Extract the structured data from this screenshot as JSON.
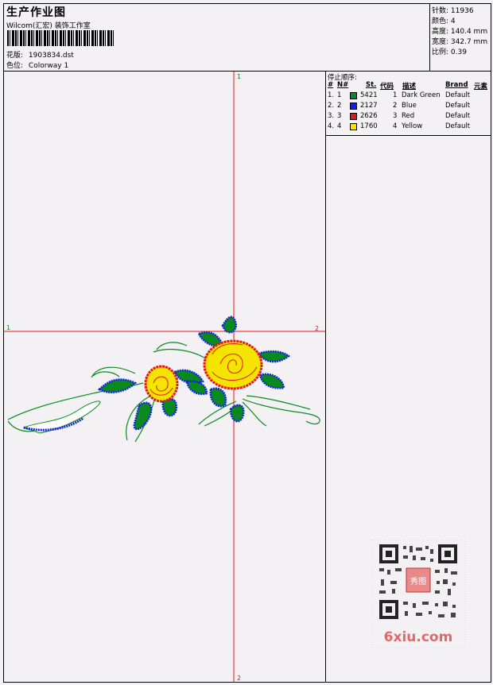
{
  "header": {
    "title": "生产作业图",
    "company": "Wilcom(汇宏) 装饰工作室",
    "design_file_label": "花版:",
    "design_file": "1903834.dst",
    "colorway_label": "色位:",
    "colorway": "Colorway 1"
  },
  "stats": [
    {
      "label": "针数:",
      "value": "11936"
    },
    {
      "label": "颜色:",
      "value": "4"
    },
    {
      "label": "高度:",
      "value": "140.4 mm"
    },
    {
      "label": "宽度:",
      "value": "342.7 mm"
    },
    {
      "label": "比例:",
      "value": "0.39"
    }
  ],
  "stop_sequence": {
    "title": "停止顺序:",
    "columns": {
      "num": "#",
      "needle": "N#",
      "stitches": "St.",
      "code": "代码",
      "description": "描述",
      "brand": "Brand",
      "element": "元素"
    },
    "rows": [
      {
        "num": "1.",
        "needle": "1",
        "color": "#0a8a1e",
        "stitches": "5421",
        "code": "1",
        "description": "Dark Green",
        "brand": "Default"
      },
      {
        "num": "2.",
        "needle": "2",
        "color": "#1020e0",
        "stitches": "2127",
        "code": "2",
        "description": "Blue",
        "brand": "Default"
      },
      {
        "num": "3.",
        "needle": "3",
        "color": "#e01818",
        "stitches": "2626",
        "code": "3",
        "description": "Red",
        "brand": "Default"
      },
      {
        "num": "4.",
        "needle": "4",
        "color": "#f4e400",
        "stitches": "1760",
        "code": "4",
        "description": "Yellow",
        "brand": "Default"
      }
    ]
  },
  "axis_labels": {
    "top": "1",
    "bottom": "2",
    "left": "1",
    "right": "2"
  },
  "watermark": "6xiu.com",
  "qr_badge": "秀图"
}
